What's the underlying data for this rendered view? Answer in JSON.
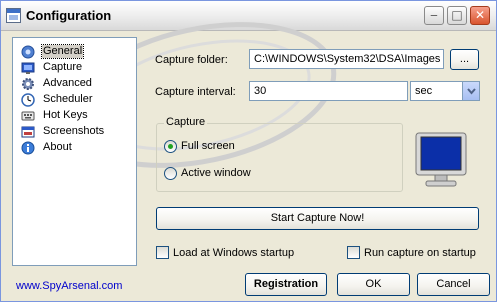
{
  "window": {
    "title": "Configuration"
  },
  "titlebar": {
    "minimize_glyph": "‒",
    "maximize_glyph": "□",
    "close_glyph": "✕"
  },
  "nav": {
    "items": [
      {
        "label": "General",
        "icon": "general-icon",
        "selected": true
      },
      {
        "label": "Capture",
        "icon": "capture-icon"
      },
      {
        "label": "Advanced",
        "icon": "advanced-icon"
      },
      {
        "label": "Scheduler",
        "icon": "scheduler-icon"
      },
      {
        "label": "Hot Keys",
        "icon": "hotkeys-icon"
      },
      {
        "label": "Screenshots",
        "icon": "screenshots-icon"
      },
      {
        "label": "About",
        "icon": "about-icon"
      }
    ]
  },
  "general": {
    "capture_folder_label": "Capture folder:",
    "capture_folder_value": "C:\\WINDOWS\\System32\\DSA\\Images",
    "browse_label": "...",
    "capture_interval_label": "Capture interval:",
    "capture_interval_value": "30",
    "interval_unit": "sec",
    "capture_group_title": "Capture",
    "full_screen_label": "Full screen",
    "active_window_label": "Active window",
    "start_capture_label": "Start Capture Now!",
    "load_startup_label": "Load at Windows startup",
    "run_capture_startup_label": "Run capture on startup"
  },
  "footer": {
    "link": "www.SpyArsenal.com",
    "registration_label": "Registration",
    "ok_label": "OK",
    "cancel_label": "Cancel"
  }
}
